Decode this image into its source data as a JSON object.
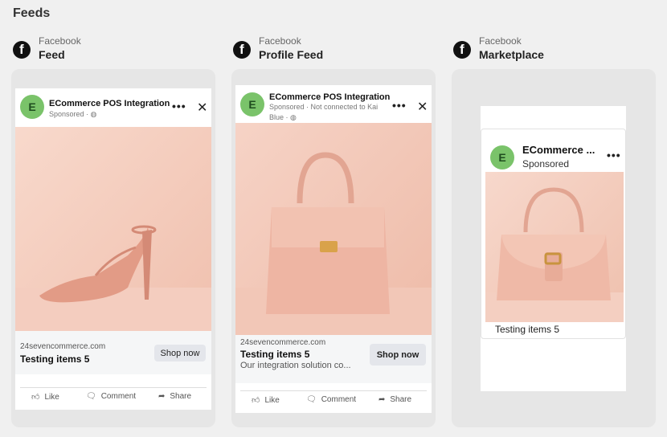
{
  "section": {
    "title": "Feeds"
  },
  "placements": [
    {
      "platform": "Facebook",
      "name": "Feed"
    },
    {
      "platform": "Facebook",
      "name": "Profile Feed"
    },
    {
      "platform": "Facebook",
      "name": "Marketplace"
    }
  ],
  "ad": {
    "avatar_letter": "E",
    "advertiser": "ECommerce POS Integration",
    "advertiser_short": "ECommerce ...",
    "sponsored": "Sponsored",
    "sponsored_feed": "Sponsored · ",
    "sponsored_profile": "Sponsored · Not connected to Kai Blue · ",
    "domain": "24sevencommerce.com",
    "product_title": "Testing items 5",
    "description": "Our integration solution co...",
    "cta": "Shop now",
    "more_icon": "•••",
    "close_icon": "✕"
  },
  "actions": {
    "like": "Like",
    "comment": "Comment",
    "share": "Share"
  },
  "colors": {
    "avatar": "#7ac36a",
    "image_bg": "#f3c9b8",
    "product": "#e8a08c"
  }
}
